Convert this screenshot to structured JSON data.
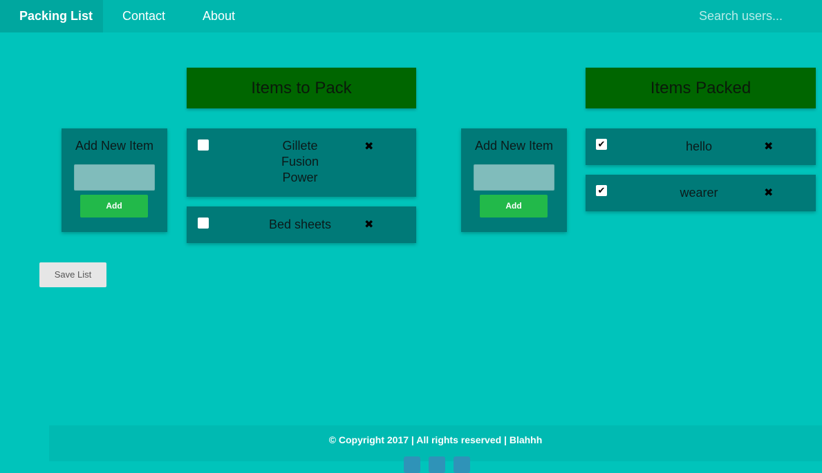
{
  "navbar": {
    "brand": "Packing List",
    "links": [
      "Contact",
      "About"
    ],
    "search_placeholder": "Search users..."
  },
  "to_pack": {
    "title": "Items to Pack",
    "add_title": "Add New Item",
    "add_label": "Add",
    "items": [
      {
        "label": "Gillete Fusion Power",
        "checked": false
      },
      {
        "label": "Bed sheets",
        "checked": false
      }
    ]
  },
  "packed": {
    "title": "Items Packed",
    "add_title": "Add New Item",
    "add_label": "Add",
    "items": [
      {
        "label": "hello",
        "checked": true
      },
      {
        "label": "wearer",
        "checked": true
      }
    ]
  },
  "save_label": "Save List",
  "footer": {
    "copyright": "© Copyright 2017 | All rights reserved | Blahhh"
  },
  "colors": {
    "page_bg": "#00c4bb",
    "header_green": "#006600",
    "card_teal": "#007a78",
    "add_button": "#22b94a"
  },
  "icons": {
    "remove": "✖",
    "check": "✔"
  }
}
